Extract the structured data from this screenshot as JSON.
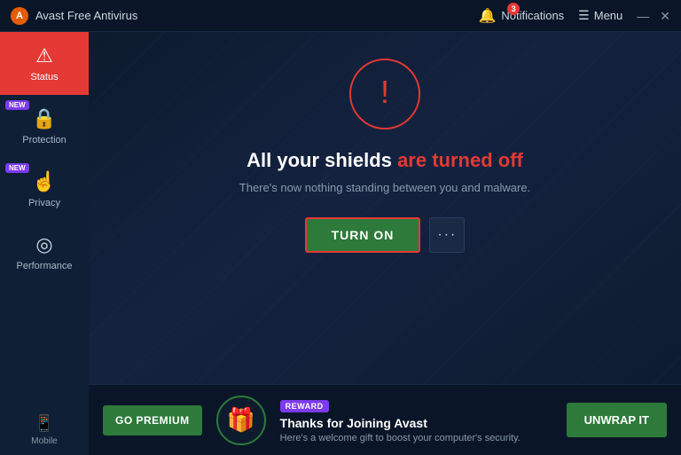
{
  "titlebar": {
    "app_icon_label": "!",
    "app_title": "Avast Free Antivirus",
    "notifications_label": "Notifications",
    "notifications_count": "3",
    "menu_label": "Menu",
    "minimize_label": "—",
    "close_label": "✕"
  },
  "sidebar": {
    "items": [
      {
        "id": "status",
        "label": "Status",
        "icon": "⚠",
        "active": true,
        "new": false
      },
      {
        "id": "protection",
        "label": "Protection",
        "icon": "🔒",
        "active": false,
        "new": true
      },
      {
        "id": "privacy",
        "label": "Privacy",
        "icon": "👆",
        "active": false,
        "new": true
      },
      {
        "id": "performance",
        "label": "Performance",
        "icon": "⊙",
        "active": false,
        "new": false
      }
    ],
    "bottom": [
      {
        "id": "mobile",
        "label": "Mobile",
        "icon": "📱"
      }
    ]
  },
  "main": {
    "warning_icon": "!",
    "headline_part1": "All your shields ",
    "headline_part2": "are turned off",
    "subtext": "There's now nothing standing between you and malware.",
    "turn_on_label": "TURN ON",
    "more_label": "···"
  },
  "banner": {
    "reward_badge": "REWARD",
    "title": "Thanks for Joining Avast",
    "subtitle": "Here's a welcome gift to boost your computer's security.",
    "go_premium_label": "GO PREMIUM",
    "unwrap_label": "UNWRAP IT"
  },
  "colors": {
    "accent_red": "#e53935",
    "accent_green": "#2d7a3a",
    "accent_purple": "#7c3aed",
    "bg_dark": "#0d1b2e",
    "sidebar_bg": "#0f1f35"
  }
}
